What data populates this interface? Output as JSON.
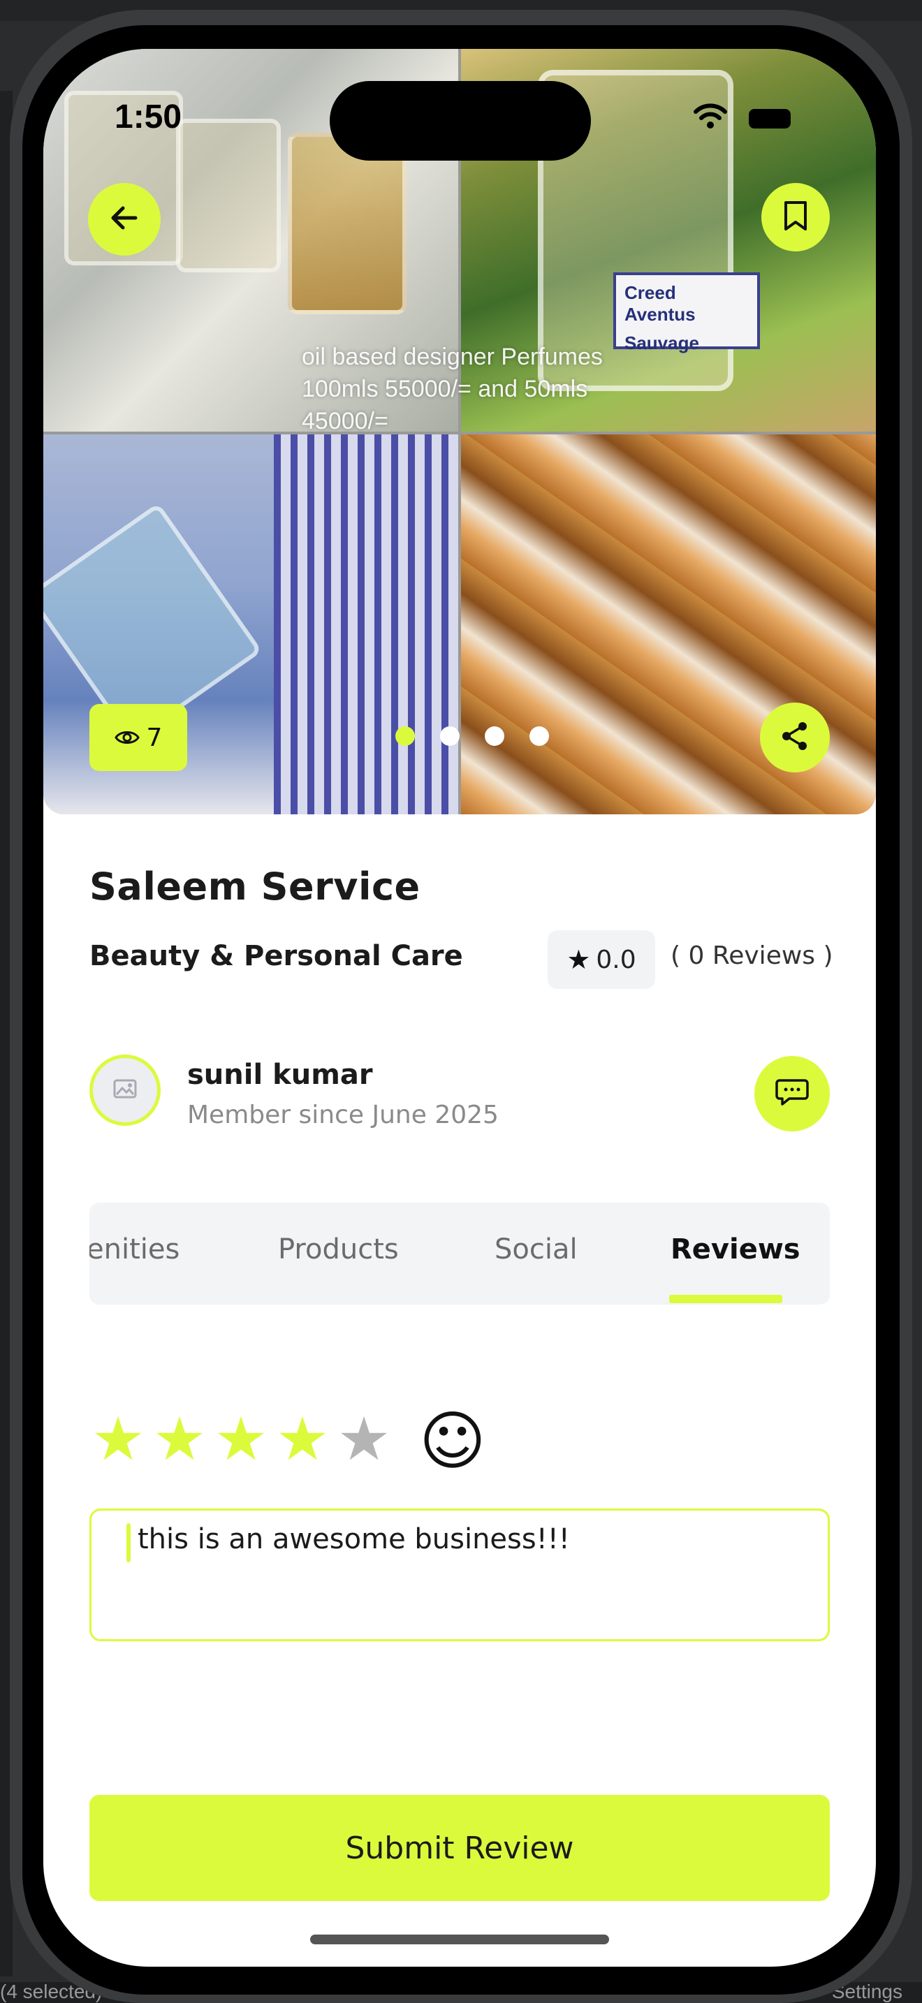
{
  "host": {
    "bottom_left": "(4 selected)",
    "bottom_right": "Settings"
  },
  "status_bar": {
    "time": "1:50"
  },
  "hero": {
    "caption": "oil based designer Perfumes\n100mls 55000/= and 50mls\n45000/=",
    "label_text": [
      "Creed Aventus",
      "Sauvage"
    ],
    "view_count": "7",
    "slides": 4,
    "active_slide": 1
  },
  "icons": {
    "back": "arrow-left-icon",
    "bookmark": "bookmark-icon",
    "views": "eye-icon",
    "share": "share-icon",
    "avatar_placeholder": "image-icon",
    "chat": "chat-bubble-icon",
    "rating_star": "star-icon",
    "smiley": "smiley-icon"
  },
  "business": {
    "name": "Saleem Service",
    "category": "Beauty & Personal Care",
    "rating": "0.0",
    "reviews": "( 0 Reviews )"
  },
  "owner": {
    "name": "sunil kumar",
    "since": "Member since June 2025"
  },
  "tabs": [
    {
      "label": "enities",
      "active": false
    },
    {
      "label": "Products",
      "active": false
    },
    {
      "label": "Social",
      "active": false
    },
    {
      "label": "Reviews",
      "active": true
    }
  ],
  "review_form": {
    "selected_rating": 4,
    "max_rating": 5,
    "text": "this is an awesome business!!!",
    "submit_label": "Submit Review"
  },
  "colors": {
    "accent": "#dcfa3c",
    "text": "#1b1b1b",
    "muted": "#8a8a8a",
    "chip_bg": "#f2f3f5"
  }
}
